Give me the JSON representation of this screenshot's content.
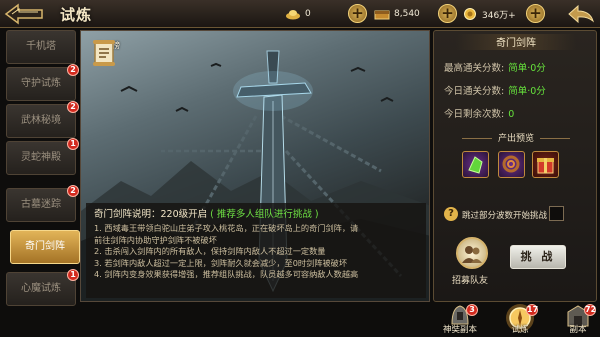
{
  "header": {
    "title": "试炼"
  },
  "resources": [
    {
      "name": "gold-ingot",
      "value": "0"
    },
    {
      "name": "silver",
      "value": "8,540"
    },
    {
      "name": "coin",
      "value": "346万+"
    }
  ],
  "tabs": [
    {
      "label": "千机塔",
      "badge": "",
      "active": false
    },
    {
      "label": "守护试炼",
      "badge": "2",
      "active": false
    },
    {
      "label": "武林秘境",
      "badge": "2",
      "active": false
    },
    {
      "label": "灵蛇神殿",
      "badge": "1",
      "active": false
    },
    {
      "label": "古墓迷踪",
      "badge": "2",
      "active": false
    },
    {
      "label": "奇门剑阵",
      "badge": "",
      "active": true
    },
    {
      "label": "心魔试炼",
      "badge": "1",
      "active": false
    }
  ],
  "scene": {
    "rank_label": "积分榜"
  },
  "description": {
    "title_prefix": "奇门剑阵说明：220级开启",
    "title_highlight": "( 推荐多人组队进行挑战 )",
    "lines": [
      "1. 西域毒王带领白驼山庄弟子攻入桃花岛，正在破坏岛上的奇门剑阵，请",
      "    前往剑阵内协助守护剑阵不被破坏",
      "2. 击杀闯入剑阵内的所有敌人，保持剑阵内敌人不超过一定数量",
      "3. 若剑阵内敌人超过一定上限，剑阵耐久就会减少，至0时剑阵被破坏",
      "4. 剑阵内变身效果获得增强，推荐组队挑战，队员越多可容纳敌人数越高"
    ]
  },
  "panel": {
    "title": "奇门剑阵",
    "stats": [
      {
        "label": "最高通关分数:",
        "value": "简单·0分"
      },
      {
        "label": "今日通关分数:",
        "value": "简单·0分"
      },
      {
        "label": "今日剩余次数:",
        "value": "0"
      }
    ],
    "reward_title": "产出预览",
    "skip_text": "跳过部分波数开始挑战",
    "team_label": "招募队友",
    "challenge_label": "挑 战"
  },
  "bottom_nav": [
    {
      "label": "神奘副本",
      "badge": "3"
    },
    {
      "label": "试炼",
      "badge": "17"
    },
    {
      "label": "副本",
      "badge": "72"
    }
  ],
  "colors": {
    "accent_gold": "#e2b458",
    "highlight_green": "#66e23c",
    "badge_red": "#d22a1f"
  }
}
